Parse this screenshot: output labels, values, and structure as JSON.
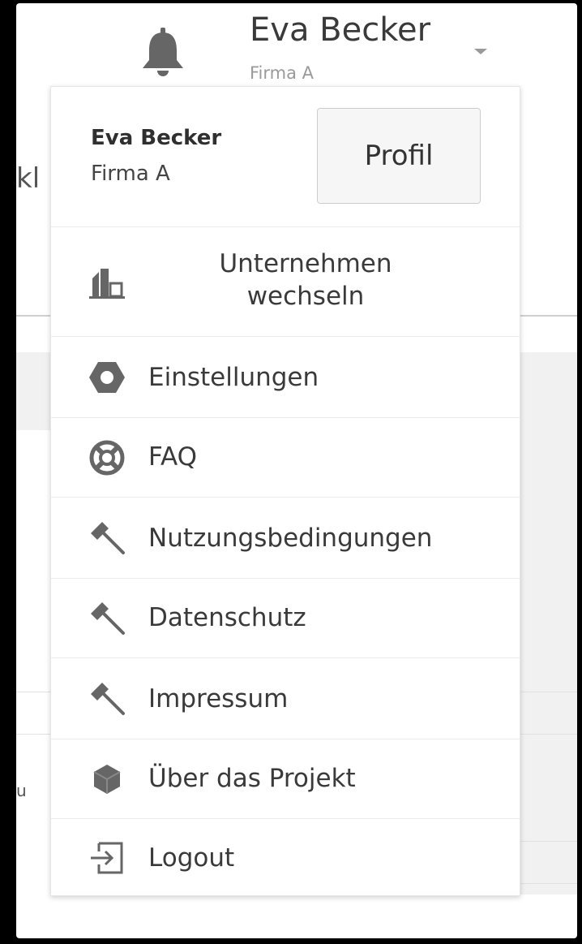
{
  "header": {
    "user_name": "Eva Becker",
    "user_org": "Firma A"
  },
  "background": {
    "left_fragment": "kl",
    "bottom_fragment": "u"
  },
  "menu": {
    "user_name": "Eva Becker",
    "user_org": "Firma A",
    "profile_button": "Profil",
    "items": [
      {
        "label": "Unternehmen wechseln",
        "icon": "building-icon"
      },
      {
        "label": "Einstellungen",
        "icon": "hexagon-icon"
      },
      {
        "label": "FAQ",
        "icon": "lifebuoy-icon"
      },
      {
        "label": "Nutzungsbedingungen",
        "icon": "gavel-icon"
      },
      {
        "label": "Datenschutz",
        "icon": "gavel-icon"
      },
      {
        "label": "Impressum",
        "icon": "gavel-icon"
      },
      {
        "label": "Über das Projekt",
        "icon": "cube-icon"
      },
      {
        "label": "Logout",
        "icon": "logout-icon"
      }
    ]
  },
  "colors": {
    "icon": "#666666",
    "text": "#3a3a3a",
    "muted": "#9a9a9a"
  }
}
